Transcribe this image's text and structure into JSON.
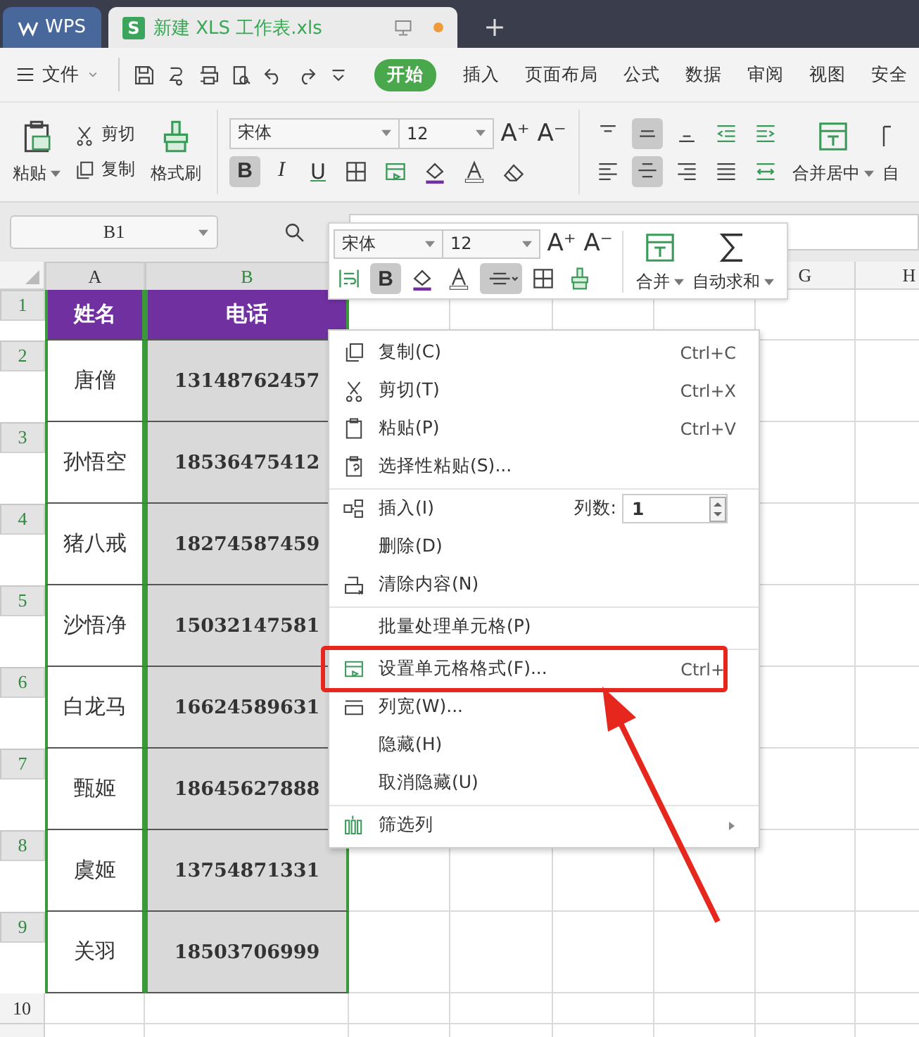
{
  "app_tabs": [
    {
      "label": "WPS",
      "kind": "home",
      "selected": false
    },
    {
      "label": "新建 XLS 工作表.xls",
      "kind": "document",
      "logo": "S",
      "selected": true,
      "unsaved": true
    }
  ],
  "menu": {
    "file": "文件",
    "tabs": [
      {
        "label": "开始",
        "selected": true
      },
      {
        "label": "插入",
        "selected": false
      },
      {
        "label": "页面布局",
        "selected": false
      },
      {
        "label": "公式",
        "selected": false
      },
      {
        "label": "数据",
        "selected": false
      },
      {
        "label": "审阅",
        "selected": false
      },
      {
        "label": "视图",
        "selected": false
      },
      {
        "label": "安全",
        "selected": false
      }
    ]
  },
  "ribbon": {
    "paste": "粘贴",
    "cut": "剪切",
    "copy": "复制",
    "format_painter": "格式刷",
    "font": "宋体",
    "size": "12",
    "grow_font": "A⁺",
    "shrink_font": "A⁻",
    "bold_label": "B",
    "italic_label": "I",
    "underline_label": "U",
    "bold": true,
    "align_center": true,
    "merge": "合并居中",
    "cut_off_label": "自"
  },
  "formula_bar": {
    "name_box": "B1"
  },
  "mini_toolbar": {
    "font": "宋体",
    "size": "12",
    "grow_font": "A⁺",
    "shrink_font": "A⁻",
    "bold_label": "B",
    "bold": true,
    "align_center": true,
    "merge": "合并",
    "autosum": "自动求和"
  },
  "sheet": {
    "columns": [
      {
        "label": "A",
        "selected": true,
        "active": false
      },
      {
        "label": "B",
        "selected": true,
        "active": true
      },
      {
        "label": "G",
        "selected": false,
        "active": false
      },
      {
        "label": "H",
        "selected": false,
        "active": false
      }
    ],
    "rows": [
      {
        "number": "1",
        "selected": true,
        "kind": "header",
        "cells": [
          "姓名",
          "电话"
        ]
      },
      {
        "number": "2",
        "selected": true,
        "kind": "data",
        "cells": [
          "唐僧",
          "13148762457"
        ]
      },
      {
        "number": "3",
        "selected": true,
        "kind": "data",
        "cells": [
          "孙悟空",
          "18536475412"
        ]
      },
      {
        "number": "4",
        "selected": true,
        "kind": "data",
        "cells": [
          "猪八戒",
          "18274587459"
        ]
      },
      {
        "number": "5",
        "selected": true,
        "kind": "data",
        "cells": [
          "沙悟净",
          "15032147581"
        ]
      },
      {
        "number": "6",
        "selected": true,
        "kind": "data",
        "cells": [
          "白龙马",
          "16624589631"
        ]
      },
      {
        "number": "7",
        "selected": true,
        "kind": "data",
        "cells": [
          "甄姬",
          "18645627888"
        ]
      },
      {
        "number": "8",
        "selected": true,
        "kind": "data",
        "cells": [
          "虞姬",
          "13754871331"
        ]
      },
      {
        "number": "9",
        "selected": true,
        "kind": "data",
        "cells": [
          "关羽",
          "18503706999"
        ]
      },
      {
        "number": "10",
        "selected": false,
        "kind": "empty"
      }
    ]
  },
  "context_menu": {
    "items": [
      {
        "label": "复制(C)",
        "shortcut": "Ctrl+C",
        "kind": "item",
        "divider_before": false,
        "highlighted": false
      },
      {
        "label": "剪切(T)",
        "shortcut": "Ctrl+X",
        "kind": "item",
        "divider_before": false,
        "highlighted": false
      },
      {
        "label": "粘贴(P)",
        "shortcut": "Ctrl+V",
        "kind": "item",
        "divider_before": false,
        "highlighted": false
      },
      {
        "label": "选择性粘贴(S)...",
        "kind": "item",
        "divider_before": false,
        "highlighted": false
      },
      {
        "label": "插入(I)",
        "kind": "insert",
        "count_label": "列数:",
        "count": "1",
        "divider_before": true,
        "highlighted": false
      },
      {
        "label": "删除(D)",
        "kind": "item",
        "divider_before": false,
        "highlighted": false
      },
      {
        "label": "清除内容(N)",
        "kind": "item",
        "divider_before": false,
        "highlighted": false
      },
      {
        "label": "批量处理单元格(P)",
        "kind": "item",
        "divider_before": true,
        "highlighted": false
      },
      {
        "label": "设置单元格格式(F)...",
        "shortcut": "Ctrl+",
        "kind": "item",
        "divider_before": true,
        "highlighted": true
      },
      {
        "label": "列宽(W)...",
        "kind": "item",
        "divider_before": false,
        "highlighted": false
      },
      {
        "label": "隐藏(H)",
        "kind": "item",
        "divider_before": false,
        "highlighted": false
      },
      {
        "label": "取消隐藏(U)",
        "kind": "item",
        "divider_before": false,
        "highlighted": false
      },
      {
        "label": "筛选列",
        "kind": "submenu",
        "divider_before": true,
        "highlighted": false
      }
    ]
  }
}
